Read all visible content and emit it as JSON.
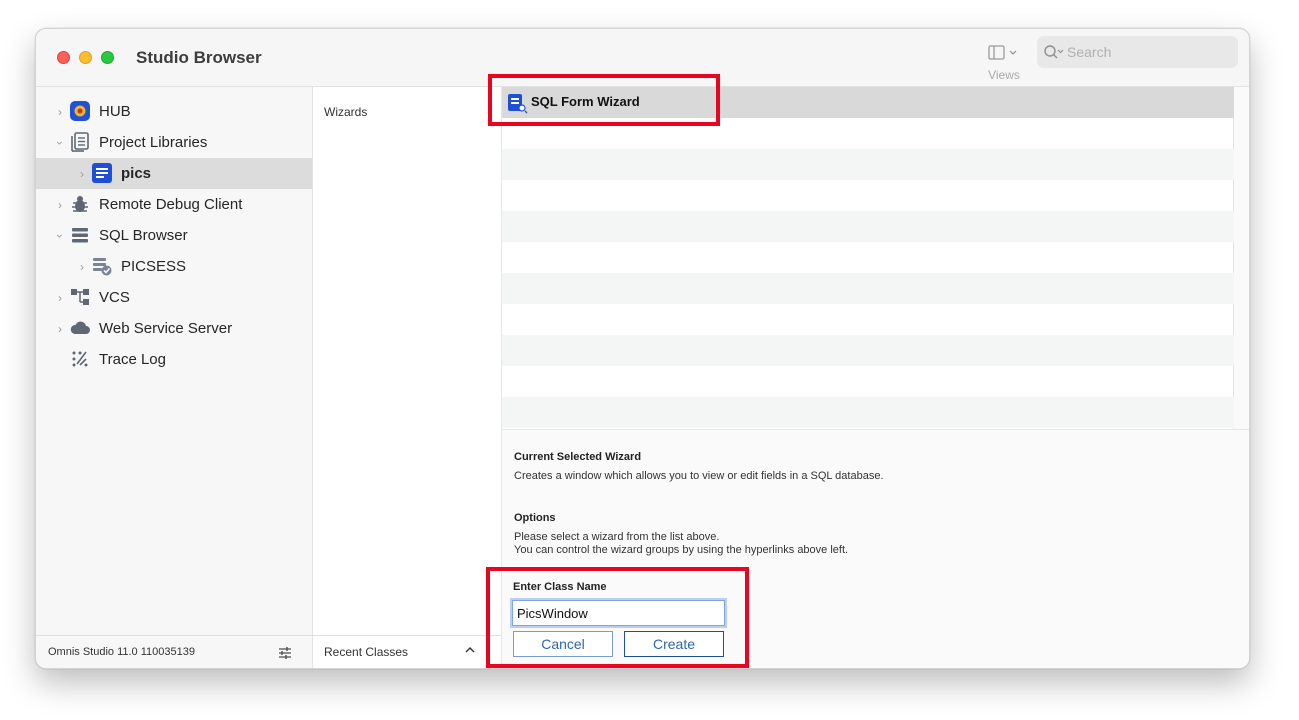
{
  "window": {
    "title": "Studio Browser"
  },
  "toolbar": {
    "views_label": "Views",
    "search_placeholder": "Search"
  },
  "sidebar": {
    "items": [
      {
        "label": "HUB",
        "expander": "collapsed"
      },
      {
        "label": "Project Libraries",
        "expander": "expanded"
      },
      {
        "label": "pics",
        "expander": "collapsed",
        "selected": true
      },
      {
        "label": "Remote Debug Client",
        "expander": "collapsed"
      },
      {
        "label": "SQL Browser",
        "expander": "expanded"
      },
      {
        "label": "PICSESS",
        "expander": "collapsed"
      },
      {
        "label": "VCS",
        "expander": "collapsed"
      },
      {
        "label": "Web Service Server",
        "expander": "collapsed"
      },
      {
        "label": "Trace Log",
        "expander": "none"
      }
    ],
    "version": "Omnis Studio 11.0 110035139"
  },
  "middle": {
    "heading": "Wizards",
    "recent_label": "Recent Classes"
  },
  "wizards": {
    "items": [
      "SQL Form Wizard"
    ]
  },
  "details": {
    "current_heading": "Current Selected Wizard",
    "current_text": "Creates a window which allows you to view or edit fields in a SQL database.",
    "options_heading": "Options",
    "options_line1": "Please select a wizard from the list above.",
    "options_line2": "You can control the wizard groups by using the hyperlinks above left."
  },
  "class_name": {
    "heading": "Enter Class Name",
    "value": "PicsWindow",
    "cancel_label": "Cancel",
    "create_label": "Create"
  },
  "colors": {
    "highlight": "#e8051f",
    "accent": "#2d66b2",
    "hub_blue": "#1f52d6"
  }
}
